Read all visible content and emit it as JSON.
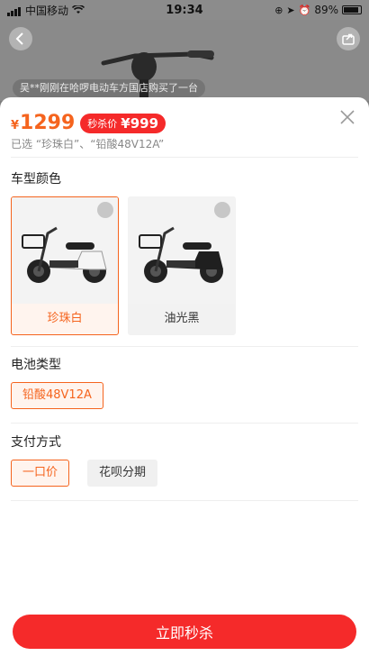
{
  "status_bar": {
    "carrier": "中国移动",
    "time": "19:34",
    "battery": "89%"
  },
  "ticker": "吴**刚刚在哈啰电动车方国店购买了一台",
  "header": {
    "currency": "¥",
    "price": "1299",
    "seckill_label": "秒杀价",
    "seckill_price": "¥999",
    "selected_text": "已选 “珍珠白”、“铅酸48V12A”"
  },
  "colors": {
    "title": "车型颜色",
    "options": [
      {
        "label": "珍珠白",
        "selected": true,
        "body_color": "#f5f5f5"
      },
      {
        "label": "油光黑",
        "selected": false,
        "body_color": "#1f1f1f"
      }
    ]
  },
  "battery": {
    "title": "电池类型",
    "options": [
      {
        "label": "铅酸48V12A",
        "selected": true
      }
    ]
  },
  "payment": {
    "title": "支付方式",
    "options": [
      {
        "label": "一口价",
        "selected": true
      },
      {
        "label": "花呗分期",
        "selected": false
      }
    ]
  },
  "buy_button": "立即秒杀",
  "accent_color": "#f5641e",
  "button_color": "#f52a2a"
}
